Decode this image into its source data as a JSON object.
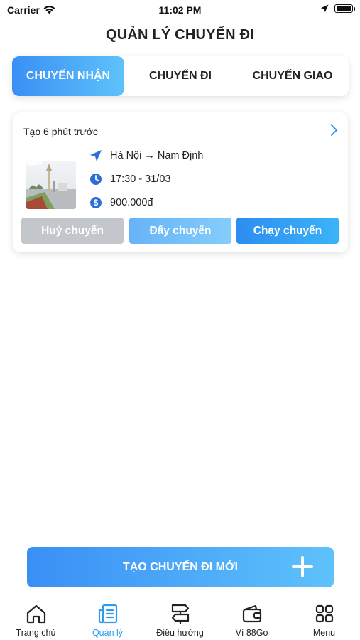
{
  "status_bar": {
    "carrier": "Carrier",
    "time": "11:02 PM"
  },
  "header": {
    "title": "QUẢN LÝ CHUYẾN ĐI"
  },
  "tabs": [
    {
      "label": "CHUYẾN NHẬN",
      "active": true
    },
    {
      "label": "CHUYẾN ĐI",
      "active": false
    },
    {
      "label": "CHUYẾN GIAO",
      "active": false
    }
  ],
  "trip": {
    "created": "Tạo 6 phút trước",
    "route": "Hà Nội → Nam Định",
    "time": "17:30 - 31/03",
    "price": "900.000đ",
    "buttons": {
      "cancel": "Huỷ chuyến",
      "push": "Đẩy chuyến",
      "run": "Chạy chuyến"
    }
  },
  "create_button": {
    "label": "TẠO CHUYẾN ĐI MỚI"
  },
  "bottom_nav": [
    {
      "label": "Trang chủ",
      "icon": "home-icon"
    },
    {
      "label": "Quản lý",
      "icon": "document-icon",
      "active": true
    },
    {
      "label": "Điều hướng",
      "icon": "signpost-icon"
    },
    {
      "label": "Ví 88Go",
      "icon": "wallet-icon"
    },
    {
      "label": "Menu",
      "icon": "grid-icon"
    }
  ],
  "colors": {
    "accent": "#2d8df1",
    "accent_light": "#5ec2fb",
    "active_nav": "#2d9cf0",
    "cancel_gray": "#c3c7cc"
  }
}
